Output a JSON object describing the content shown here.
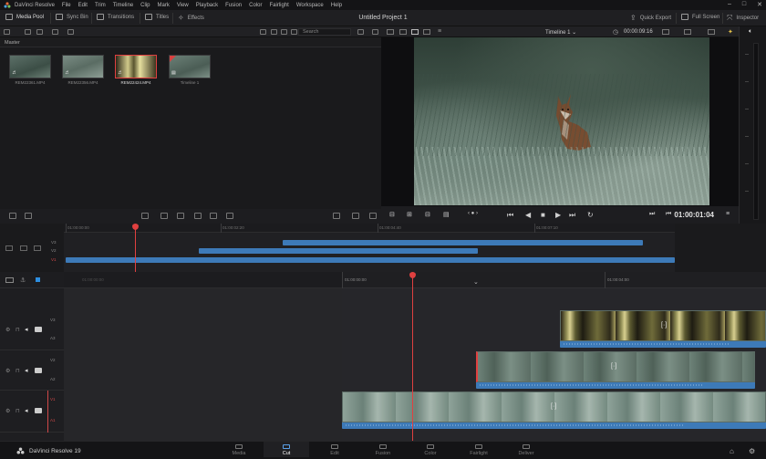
{
  "menubar": {
    "app_name": "DaVinci Resolve",
    "items": [
      "File",
      "Edit",
      "Trim",
      "Timeline",
      "Clip",
      "Mark",
      "View",
      "Playback",
      "Fusion",
      "Color",
      "Fairlight",
      "Workspace",
      "Help"
    ],
    "window_controls": [
      "–",
      "□",
      "✕"
    ]
  },
  "toolbar": {
    "media_pool": "Media Pool",
    "sync_bin": "Sync Bin",
    "transitions": "Transitions",
    "titles": "Titles",
    "effects": "Effects",
    "project_title": "Untitled Project 1",
    "quick_export": "Quick Export",
    "full_screen": "Full Screen",
    "inspector": "Inspector"
  },
  "media_pool": {
    "search_placeholder": "Search",
    "bin": "Master",
    "clips": [
      {
        "name": "REM22361.MP4",
        "selected": false
      },
      {
        "name": "REM22356.MP4",
        "selected": false
      },
      {
        "name": "REM22424.MP4",
        "selected": true
      },
      {
        "name": "Timeline 1",
        "selected": false
      }
    ]
  },
  "viewer": {
    "timeline_name": "Timeline 1",
    "source_timecode": "00:00:09:16",
    "record_timecode": "01:00:01:04"
  },
  "overview": {
    "ruler": [
      "01:00:00:00",
      "01:00:02:20",
      "01:00:04:40",
      "01:00:07:10"
    ],
    "tracks": [
      "V3",
      "V2",
      "V1"
    ]
  },
  "timeline": {
    "ruler_dim": "01:00:00:00",
    "ruler": [
      "01:00:00:00",
      "01:00:04:00"
    ],
    "tracks": [
      {
        "video": "V3",
        "audio": "A3"
      },
      {
        "video": "V2",
        "audio": "A2"
      },
      {
        "video": "V1",
        "audio": "A1"
      }
    ]
  },
  "pages": {
    "brand": "DaVinci Resolve 19",
    "items": [
      "Media",
      "Cut",
      "Edit",
      "Fusion",
      "Color",
      "Fairlight",
      "Deliver"
    ],
    "active": "Cut"
  }
}
